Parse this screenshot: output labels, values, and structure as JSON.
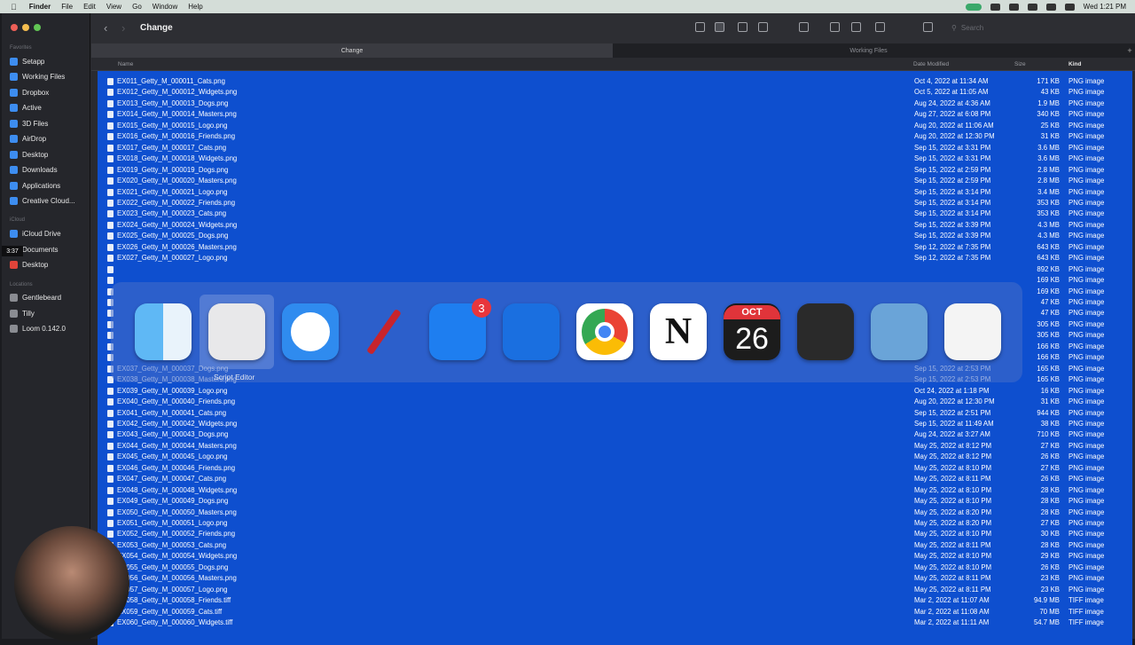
{
  "menubar": {
    "app": "Finder",
    "items": [
      "File",
      "Edit",
      "View",
      "Go",
      "Window",
      "Help"
    ],
    "clock": "Wed 1:21 PM"
  },
  "toolbar": {
    "title": "Change",
    "search_placeholder": "Search"
  },
  "tabs": [
    {
      "label": "Change",
      "active": true
    },
    {
      "label": "Working Files",
      "active": false
    }
  ],
  "sidebar": {
    "favorites_header": "Favorites",
    "favorites": [
      "Setapp",
      "Working Files",
      "Dropbox",
      "Active",
      "3D Files",
      "AirDrop",
      "Desktop",
      "Downloads",
      "Applications",
      "Creative Cloud..."
    ],
    "icloud_header": "iCloud",
    "icloud": [
      "iCloud Drive",
      "Documents",
      "Desktop"
    ],
    "locations_header": "Locations",
    "locations": [
      "Gentlebeard",
      "Tilly",
      "Loom 0.142.0"
    ]
  },
  "columns": {
    "name": "Name",
    "date": "Date Modified",
    "size": "Size",
    "kind": "Kind"
  },
  "timer": "3:37",
  "files": [
    {
      "name": "EX011_Getty_M_000011_Cats.png",
      "date": "Oct 4, 2022 at 11:34 AM",
      "size": "171 KB",
      "kind": "PNG image"
    },
    {
      "name": "EX012_Getty_M_000012_Widgets.png",
      "date": "Oct 5, 2022 at 11:05 AM",
      "size": "43 KB",
      "kind": "PNG image"
    },
    {
      "name": "EX013_Getty_M_000013_Dogs.png",
      "date": "Aug 24, 2022 at 4:36 AM",
      "size": "1.9 MB",
      "kind": "PNG image"
    },
    {
      "name": "EX014_Getty_M_000014_Masters.png",
      "date": "Aug 27, 2022 at 6:08 PM",
      "size": "340 KB",
      "kind": "PNG image"
    },
    {
      "name": "EX015_Getty_M_000015_Logo.png",
      "date": "Aug 20, 2022 at 11:06 AM",
      "size": "25 KB",
      "kind": "PNG image"
    },
    {
      "name": "EX016_Getty_M_000016_Friends.png",
      "date": "Aug 20, 2022 at 12:30 PM",
      "size": "31 KB",
      "kind": "PNG image"
    },
    {
      "name": "EX017_Getty_M_000017_Cats.png",
      "date": "Sep 15, 2022 at 3:31 PM",
      "size": "3.6 MB",
      "kind": "PNG image"
    },
    {
      "name": "EX018_Getty_M_000018_Widgets.png",
      "date": "Sep 15, 2022 at 3:31 PM",
      "size": "3.6 MB",
      "kind": "PNG image"
    },
    {
      "name": "EX019_Getty_M_000019_Dogs.png",
      "date": "Sep 15, 2022 at 2:59 PM",
      "size": "2.8 MB",
      "kind": "PNG image"
    },
    {
      "name": "EX020_Getty_M_000020_Masters.png",
      "date": "Sep 15, 2022 at 2:59 PM",
      "size": "2.8 MB",
      "kind": "PNG image"
    },
    {
      "name": "EX021_Getty_M_000021_Logo.png",
      "date": "Sep 15, 2022 at 3:14 PM",
      "size": "3.4 MB",
      "kind": "PNG image"
    },
    {
      "name": "EX022_Getty_M_000022_Friends.png",
      "date": "Sep 15, 2022 at 3:14 PM",
      "size": "353 KB",
      "kind": "PNG image"
    },
    {
      "name": "EX023_Getty_M_000023_Cats.png",
      "date": "Sep 15, 2022 at 3:14 PM",
      "size": "353 KB",
      "kind": "PNG image"
    },
    {
      "name": "EX024_Getty_M_000024_Widgets.png",
      "date": "Sep 15, 2022 at 3:39 PM",
      "size": "4.3 MB",
      "kind": "PNG image"
    },
    {
      "name": "EX025_Getty_M_000025_Dogs.png",
      "date": "Sep 15, 2022 at 3:39 PM",
      "size": "4.3 MB",
      "kind": "PNG image"
    },
    {
      "name": "EX026_Getty_M_000026_Masters.png",
      "date": "Sep 12, 2022 at 7:35 PM",
      "size": "643 KB",
      "kind": "PNG image"
    },
    {
      "name": "EX027_Getty_M_000027_Logo.png",
      "date": "Sep 12, 2022 at 7:35 PM",
      "size": "643 KB",
      "kind": "PNG image"
    },
    {
      "name": "",
      "date": "",
      "size": "892 KB",
      "kind": "PNG image"
    },
    {
      "name": "",
      "date": "",
      "size": "169 KB",
      "kind": "PNG image"
    },
    {
      "name": "",
      "date": "",
      "size": "169 KB",
      "kind": "PNG image"
    },
    {
      "name": "",
      "date": "",
      "size": "47 KB",
      "kind": "PNG image"
    },
    {
      "name": "",
      "date": "",
      "size": "47 KB",
      "kind": "PNG image"
    },
    {
      "name": "",
      "date": "",
      "size": "305 KB",
      "kind": "PNG image"
    },
    {
      "name": "",
      "date": "",
      "size": "305 KB",
      "kind": "PNG image"
    },
    {
      "name": "",
      "date": "",
      "size": "166 KB",
      "kind": "PNG image"
    },
    {
      "name": "",
      "date": "",
      "size": "166 KB",
      "kind": "PNG image"
    },
    {
      "name": "EX037_Getty_M_000037_Dogs.png",
      "date": "Sep 15, 2022 at 2:53 PM",
      "size": "165 KB",
      "kind": "PNG image"
    },
    {
      "name": "EX038_Getty_M_000038_Masters.png",
      "date": "Sep 15, 2022 at 2:53 PM",
      "size": "165 KB",
      "kind": "PNG image"
    },
    {
      "name": "EX039_Getty_M_000039_Logo.png",
      "date": "Oct 24, 2022 at 1:18 PM",
      "size": "16 KB",
      "kind": "PNG image"
    },
    {
      "name": "EX040_Getty_M_000040_Friends.png",
      "date": "Aug 20, 2022 at 12:30 PM",
      "size": "31 KB",
      "kind": "PNG image"
    },
    {
      "name": "EX041_Getty_M_000041_Cats.png",
      "date": "Sep 15, 2022 at 2:51 PM",
      "size": "944 KB",
      "kind": "PNG image"
    },
    {
      "name": "EX042_Getty_M_000042_Widgets.png",
      "date": "Sep 15, 2022 at 11:49 AM",
      "size": "38 KB",
      "kind": "PNG image"
    },
    {
      "name": "EX043_Getty_M_000043_Dogs.png",
      "date": "Aug 24, 2022 at 3:27 AM",
      "size": "710 KB",
      "kind": "PNG image"
    },
    {
      "name": "EX044_Getty_M_000044_Masters.png",
      "date": "May 25, 2022 at 8:12 PM",
      "size": "27 KB",
      "kind": "PNG image"
    },
    {
      "name": "EX045_Getty_M_000045_Logo.png",
      "date": "May 25, 2022 at 8:12 PM",
      "size": "26 KB",
      "kind": "PNG image"
    },
    {
      "name": "EX046_Getty_M_000046_Friends.png",
      "date": "May 25, 2022 at 8:10 PM",
      "size": "27 KB",
      "kind": "PNG image"
    },
    {
      "name": "EX047_Getty_M_000047_Cats.png",
      "date": "May 25, 2022 at 8:11 PM",
      "size": "26 KB",
      "kind": "PNG image"
    },
    {
      "name": "EX048_Getty_M_000048_Widgets.png",
      "date": "May 25, 2022 at 8:10 PM",
      "size": "28 KB",
      "kind": "PNG image"
    },
    {
      "name": "EX049_Getty_M_000049_Dogs.png",
      "date": "May 25, 2022 at 8:10 PM",
      "size": "28 KB",
      "kind": "PNG image"
    },
    {
      "name": "EX050_Getty_M_000050_Masters.png",
      "date": "May 25, 2022 at 8:20 PM",
      "size": "28 KB",
      "kind": "PNG image"
    },
    {
      "name": "EX051_Getty_M_000051_Logo.png",
      "date": "May 25, 2022 at 8:20 PM",
      "size": "27 KB",
      "kind": "PNG image"
    },
    {
      "name": "EX052_Getty_M_000052_Friends.png",
      "date": "May 25, 2022 at 8:10 PM",
      "size": "30 KB",
      "kind": "PNG image"
    },
    {
      "name": "EX053_Getty_M_000053_Cats.png",
      "date": "May 25, 2022 at 8:11 PM",
      "size": "28 KB",
      "kind": "PNG image"
    },
    {
      "name": "EX054_Getty_M_000054_Widgets.png",
      "date": "May 25, 2022 at 8:10 PM",
      "size": "29 KB",
      "kind": "PNG image"
    },
    {
      "name": "EX055_Getty_M_000055_Dogs.png",
      "date": "May 25, 2022 at 8:10 PM",
      "size": "26 KB",
      "kind": "PNG image"
    },
    {
      "name": "EX056_Getty_M_000056_Masters.png",
      "date": "May 25, 2022 at 8:11 PM",
      "size": "23 KB",
      "kind": "PNG image"
    },
    {
      "name": "EX057_Getty_M_000057_Logo.png",
      "date": "May 25, 2022 at 8:11 PM",
      "size": "23 KB",
      "kind": "PNG image"
    },
    {
      "name": "EX058_Getty_M_000058_Friends.tiff",
      "date": "Mar 2, 2022 at 11:07 AM",
      "size": "94.9 MB",
      "kind": "TIFF image"
    },
    {
      "name": "EX059_Getty_M_000059_Cats.tiff",
      "date": "Mar 2, 2022 at 11:08 AM",
      "size": "70 MB",
      "kind": "TIFF image"
    },
    {
      "name": "EX060_Getty_M_000060_Widgets.tiff",
      "date": "Mar 2, 2022 at 11:11 AM",
      "size": "54.7 MB",
      "kind": "TIFF image"
    }
  ],
  "app_switcher": {
    "selected_label": "Script Editor",
    "apps": [
      {
        "icon": "finder-icon",
        "color": "#3f9bf0"
      },
      {
        "icon": "script-editor-icon",
        "color": "#e8e8ea"
      },
      {
        "icon": "safari-icon",
        "color": "#2f8bef"
      },
      {
        "icon": "pen-icon",
        "color": "#c8242c"
      },
      {
        "icon": "spark-mail-icon",
        "color": "#1e7ef0",
        "badge": "3"
      },
      {
        "icon": "surfshark-icon",
        "color": "#1a6fe0"
      },
      {
        "icon": "chrome-icon",
        "color": "#ffffff"
      },
      {
        "icon": "notion-icon",
        "color": "#ffffff",
        "glyph": "N"
      },
      {
        "icon": "calendar-icon",
        "color": "#1c1c1c",
        "month": "OCT",
        "day": "26"
      },
      {
        "icon": "tes-icon",
        "color": "#2a2a2a"
      },
      {
        "icon": "preview-icon",
        "color": "#6aa4d8"
      },
      {
        "icon": "textedit-icon",
        "color": "#f4f4f4"
      }
    ]
  }
}
